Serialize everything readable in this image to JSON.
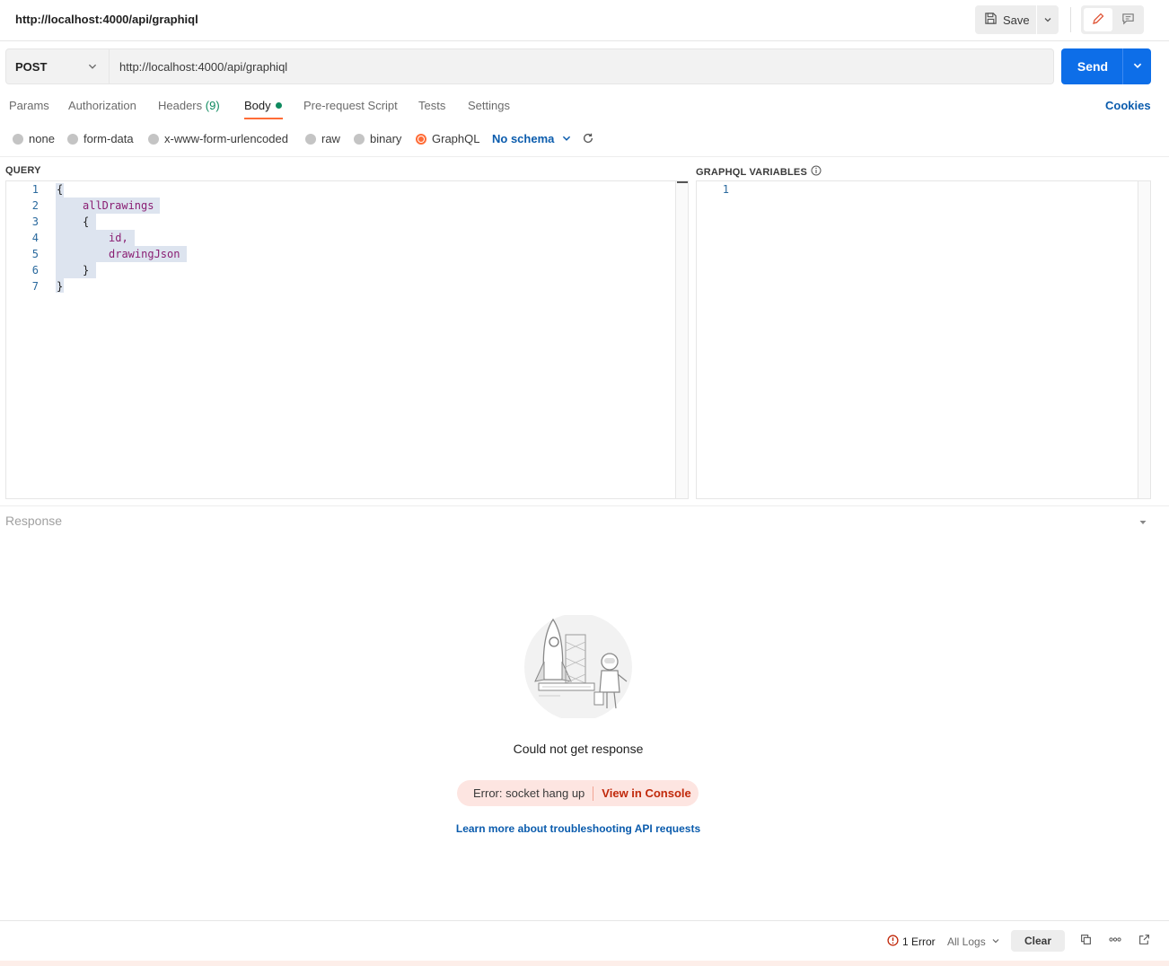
{
  "header": {
    "title": "http://localhost:4000/api/graphiql",
    "save_label": "Save"
  },
  "request": {
    "method": "POST",
    "url": "http://localhost:4000/api/graphiql",
    "send_label": "Send"
  },
  "tabs": {
    "params": "Params",
    "authorization": "Authorization",
    "headers": "Headers",
    "headers_count": "(9)",
    "body": "Body",
    "prerequest": "Pre-request Script",
    "tests": "Tests",
    "settings": "Settings",
    "cookies": "Cookies"
  },
  "body_types": {
    "none": "none",
    "form_data": "form-data",
    "urlencoded": "x-www-form-urlencoded",
    "raw": "raw",
    "binary": "binary",
    "graphql": "GraphQL",
    "selected": "GraphQL",
    "schema": "No schema"
  },
  "query": {
    "label": "QUERY",
    "lines": [
      {
        "num": "1",
        "text": "{"
      },
      {
        "num": "2",
        "text": "allDrawings"
      },
      {
        "num": "3",
        "text": "{"
      },
      {
        "num": "4",
        "text": "id,"
      },
      {
        "num": "5",
        "text": "drawingJson"
      },
      {
        "num": "6",
        "text": "}"
      },
      {
        "num": "7",
        "text": "}"
      }
    ]
  },
  "variables": {
    "label": "GRAPHQL VARIABLES",
    "lines": [
      {
        "num": "1",
        "text": ""
      }
    ]
  },
  "response": {
    "label": "Response",
    "message": "Could not get response",
    "error_text": "Error: socket hang up",
    "view_console": "View in Console",
    "learn_more": "Learn more about troubleshooting API requests"
  },
  "statusbar": {
    "errors": "1 Error",
    "logs": "All Logs",
    "clear": "Clear"
  },
  "colors": {
    "accent": "#ff6c37",
    "primary": "#0d6ee8",
    "link": "#0b5cad",
    "success": "#0f8a5f",
    "error": "#c1290b"
  },
  "icons": [
    "save-icon",
    "chevron-down-icon",
    "edit-icon",
    "comment-icon",
    "refresh-icon",
    "info-icon",
    "error-icon",
    "copy-icon",
    "more-icon",
    "external-link-icon"
  ]
}
